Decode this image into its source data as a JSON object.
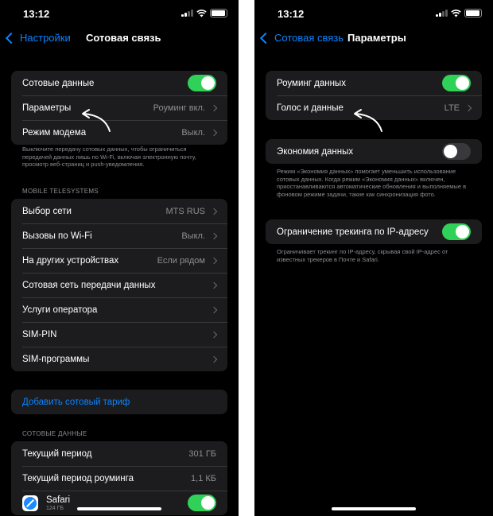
{
  "left": {
    "status": {
      "time": "13:12"
    },
    "nav": {
      "back": "Настройки",
      "title": "Сотовая связь"
    },
    "group1": [
      {
        "label": "Сотовые данные",
        "toggle": "on"
      },
      {
        "label": "Параметры",
        "value": "Роуминг вкл."
      },
      {
        "label": "Режим модема",
        "value": "Выкл."
      }
    ],
    "note1": "Выключите передачу сотовых данных, чтобы ограничиться передачей данных лишь по Wi-Fi, включая электронную почту, просмотр веб-страниц и push-уведомления.",
    "carrier_header": "MOBILE TELESYSTEMS",
    "group2": [
      {
        "label": "Выбор сети",
        "value": "MTS RUS"
      },
      {
        "label": "Вызовы по Wi-Fi",
        "value": "Выкл."
      },
      {
        "label": "На других устройствах",
        "value": "Если рядом"
      },
      {
        "label": "Сотовая сеть передачи данных",
        "value": ""
      },
      {
        "label": "Услуги оператора",
        "value": ""
      },
      {
        "label": "SIM-PIN",
        "value": ""
      },
      {
        "label": "SIM-программы",
        "value": ""
      }
    ],
    "add_plan": "Добавить сотовый тариф",
    "data_header": "СОТОВЫЕ ДАННЫЕ",
    "group4": [
      {
        "label": "Текущий период",
        "value": "301 ГБ"
      },
      {
        "label": "Текущий период роуминга",
        "value": "1,1 КБ"
      }
    ],
    "app": {
      "name": "Safari",
      "size": "124 ГБ",
      "toggle": "on"
    }
  },
  "right": {
    "status": {
      "time": "13:12"
    },
    "nav": {
      "back": "Сотовая связь",
      "title": "Параметры"
    },
    "group1": [
      {
        "label": "Роуминг данных",
        "toggle": "on"
      },
      {
        "label": "Голос и данные",
        "value": "LTE"
      }
    ],
    "group2": [
      {
        "label": "Экономия данных",
        "toggle": "off"
      }
    ],
    "note2": "Режим «Экономия данных» помогает уменьшить использование сотовых данных. Когда режим «Экономия данных» включен, приостанавливаются автоматические обновления и выполняемые в фоновом режиме задачи, такие как синхронизация фото.",
    "group3": [
      {
        "label": "Ограничение трекинга по IP-адресу",
        "toggle": "on"
      }
    ],
    "note3": "Ограничивает трекинг по IP-адресу, скрывая свой IP-адрес от известных трекеров в Почте и Safari."
  },
  "colors": {
    "accent": "#0a84ff",
    "toggle_on": "#30d158",
    "background": "#000000",
    "cell": "#1c1c1e"
  }
}
